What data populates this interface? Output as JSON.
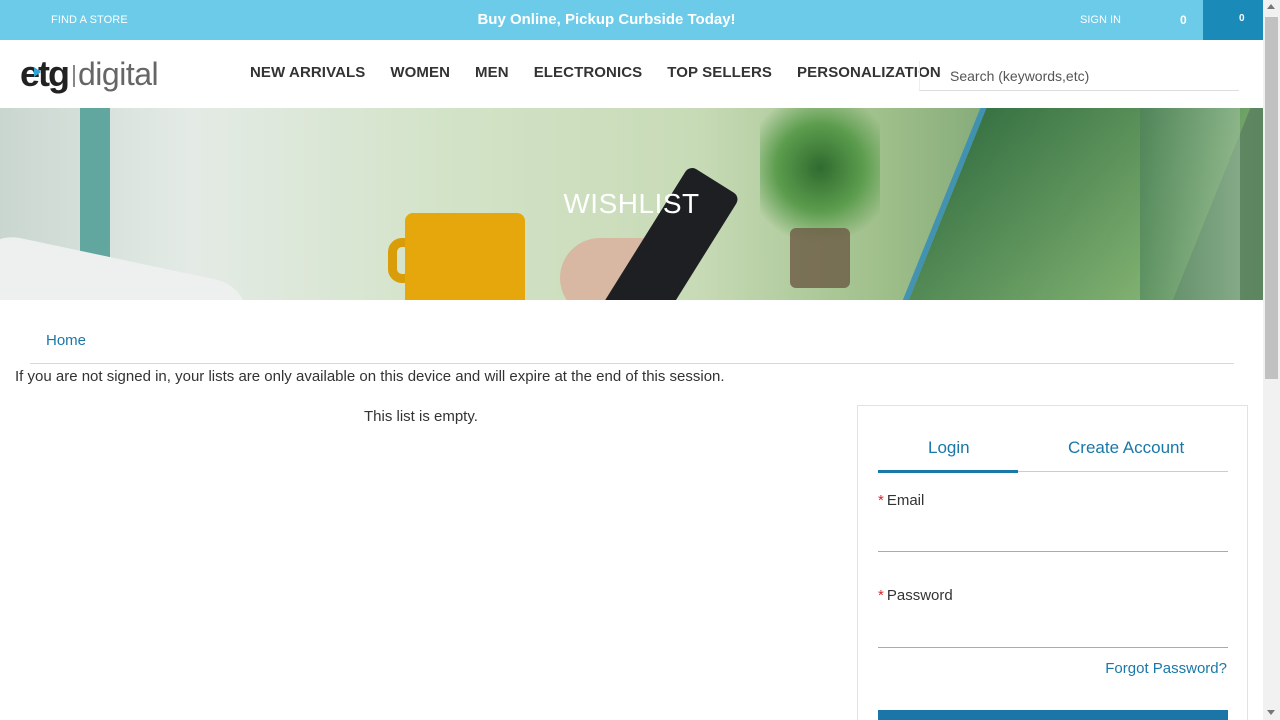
{
  "topbar": {
    "find_store": "FIND A STORE",
    "promo": "Buy Online, Pickup Curbside Today!",
    "sign_in": "SIGN IN",
    "wishlist_count": "0",
    "cart_count": "0"
  },
  "header": {
    "logo_brand": "etg",
    "logo_suffix": "digital",
    "nav": [
      "NEW ARRIVALS",
      "WOMEN",
      "MEN",
      "ELECTRONICS",
      "TOP SELLERS",
      "PERSONALIZATION"
    ],
    "search_placeholder": "Search (keywords,etc)"
  },
  "hero": {
    "title": "WISHLIST"
  },
  "breadcrumb": {
    "home": "Home"
  },
  "notice": "If you are not signed in, your lists are only available on this device and will expire at the end of this session.",
  "list_empty": "This list is empty.",
  "login_panel": {
    "tabs": [
      "Login",
      "Create Account"
    ],
    "active_tab": "Login",
    "required_marker": "*",
    "email_label": "Email",
    "password_label": "Password",
    "email_value": "",
    "password_value": "",
    "forgot_password": "Forgot Password?"
  },
  "colors": {
    "topbar_bg": "#6ccbe9",
    "cart_bg": "#1a8ab8",
    "link": "#1a78a8",
    "required": "#d9262a",
    "primary_button": "#1b75a6"
  },
  "icons": [
    "search-icon",
    "logo-arrow-icon"
  ]
}
